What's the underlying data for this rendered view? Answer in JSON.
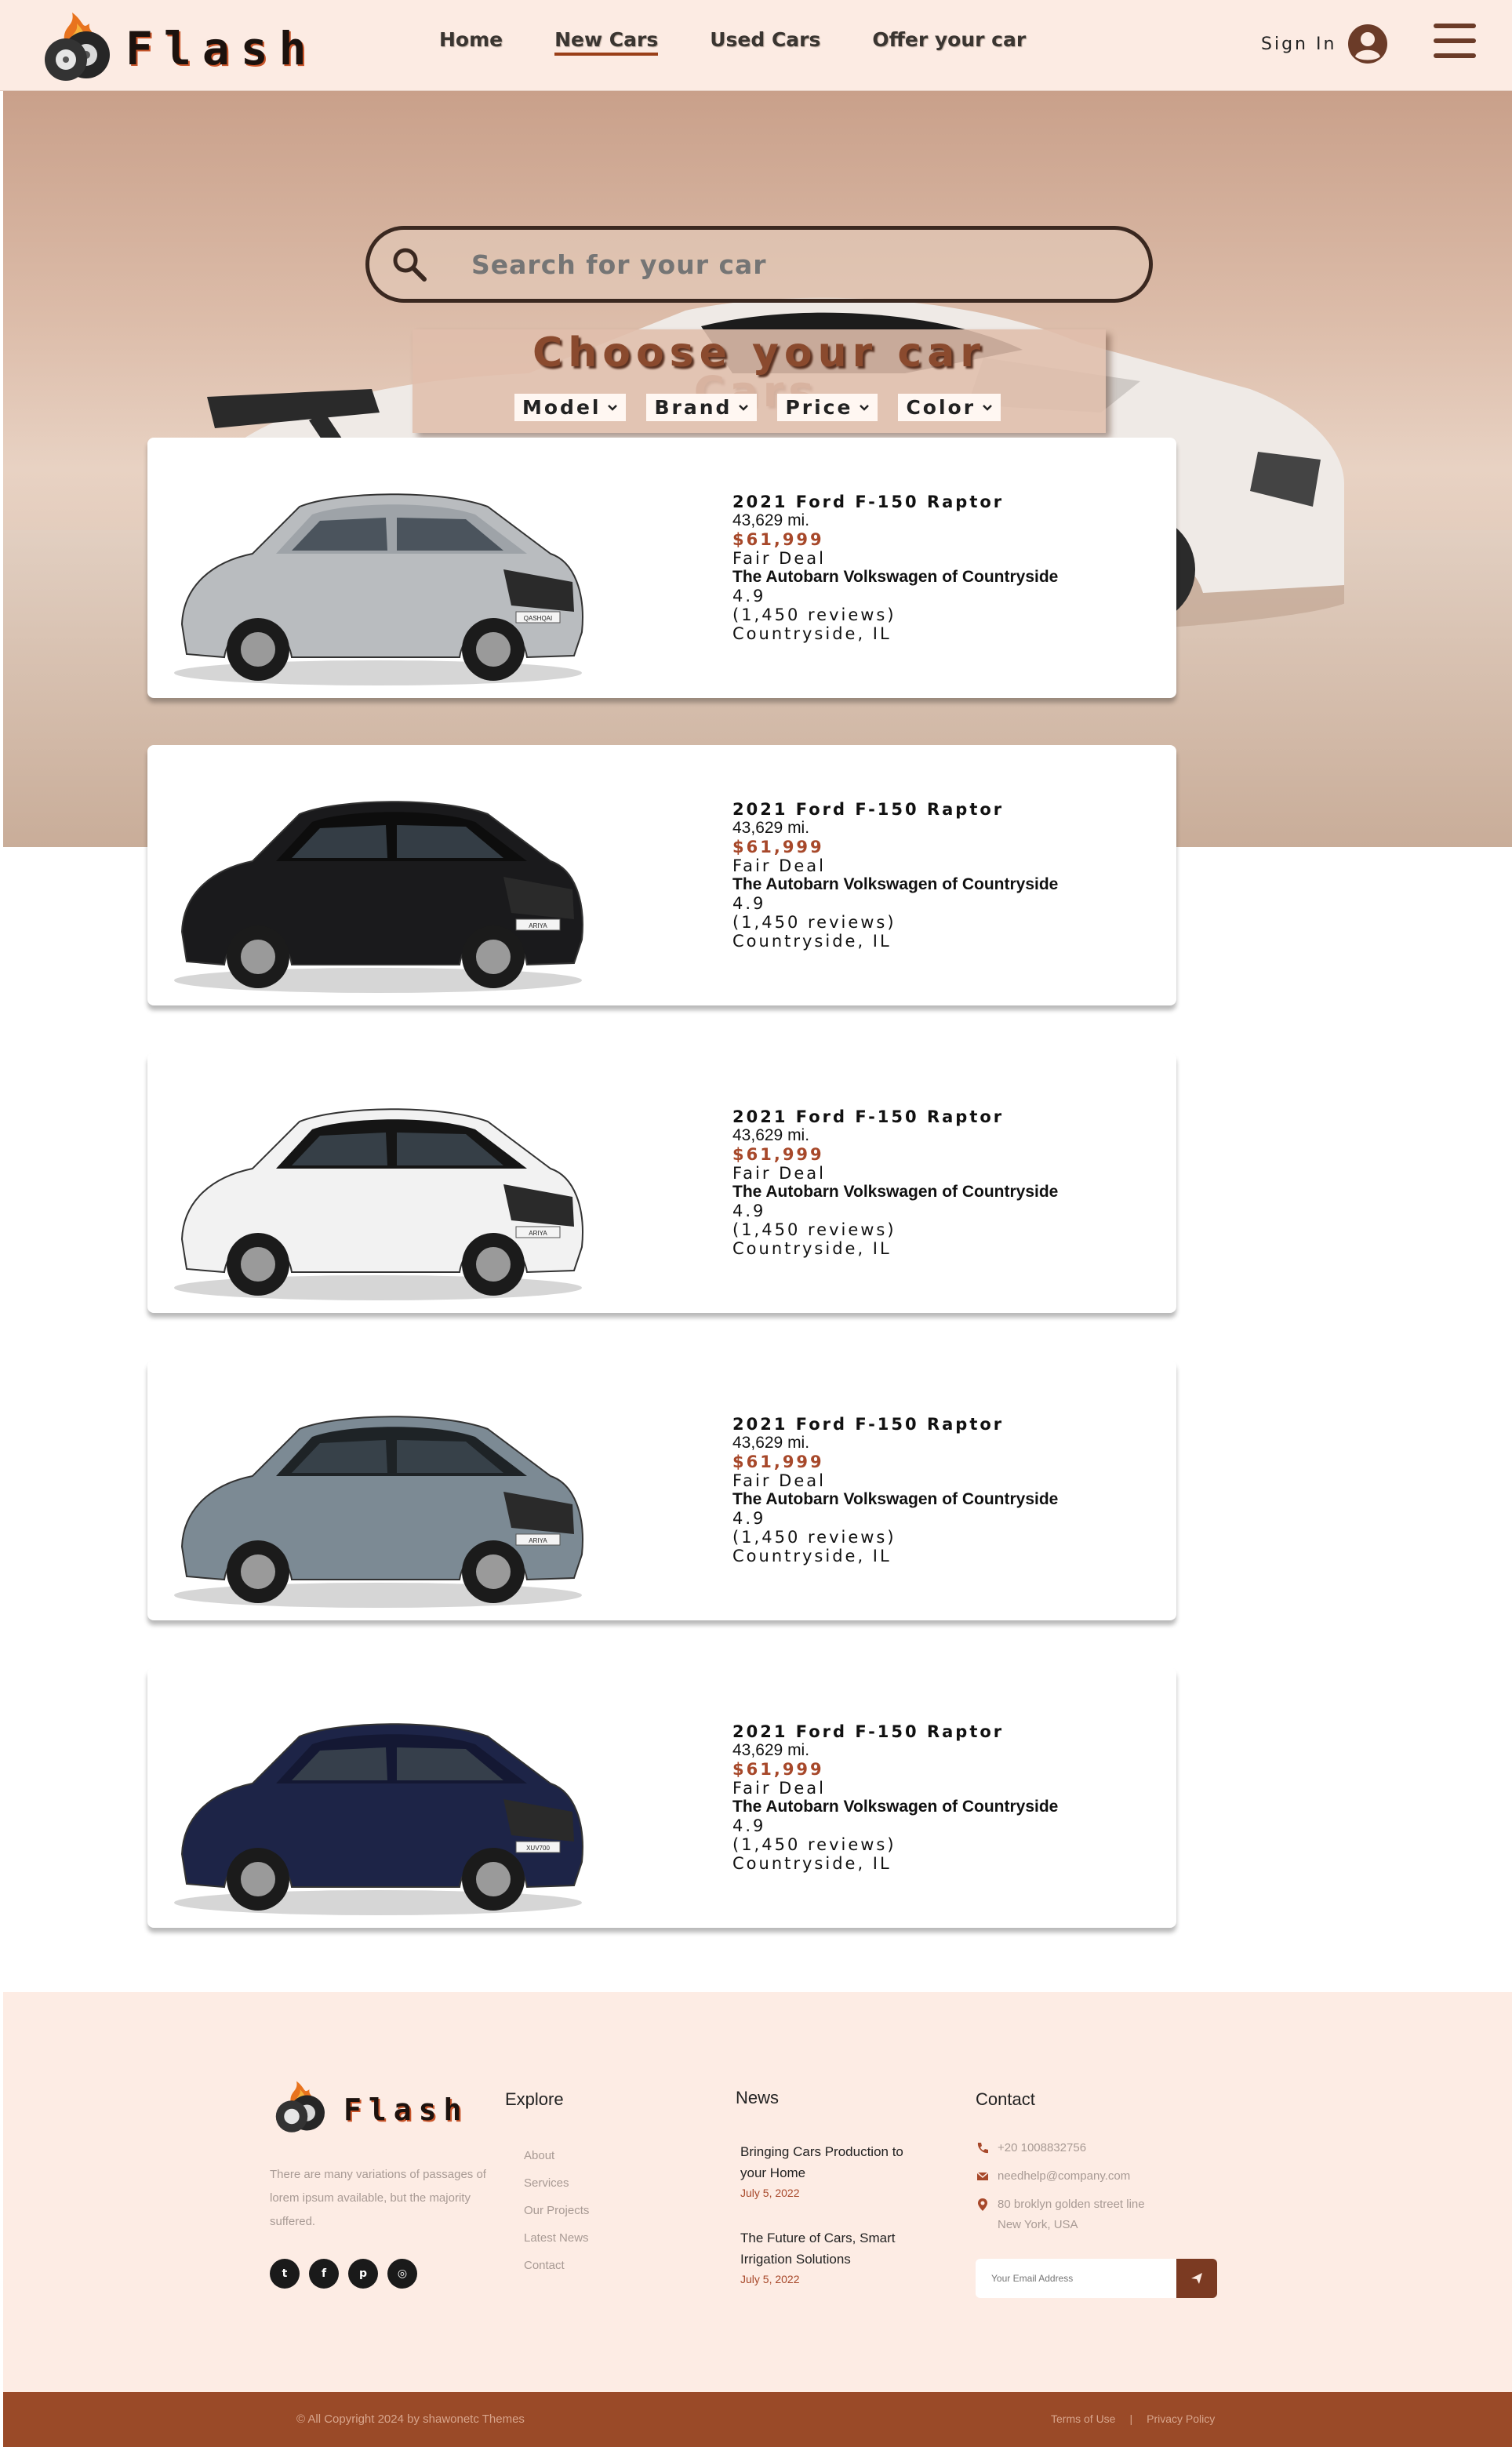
{
  "brand": {
    "name": "Flash"
  },
  "nav": {
    "items": [
      {
        "label": "Home"
      },
      {
        "label": "New Cars"
      },
      {
        "label": "Used Cars"
      },
      {
        "label": "Offer your car"
      }
    ],
    "active": "New Cars",
    "signin_label": "Sign In",
    "signin_icon": "user-circle-icon",
    "menu_icon": "hamburger-menu-icon"
  },
  "search": {
    "placeholder": "Search for your car",
    "icon": "search-icon"
  },
  "chooser": {
    "title": "Choose your car",
    "filters": [
      {
        "label": "Model"
      },
      {
        "label": "Brand"
      },
      {
        "label": "Price"
      },
      {
        "label": "Color"
      }
    ]
  },
  "section_heading": "Cars",
  "listings": [
    {
      "title": "2021 Ford F-150 Raptor",
      "mileage": "43,629 mi.",
      "price": "$61,999",
      "deal": "Fair Deal",
      "dealer": "The Autobarn Volkswagen of Countryside",
      "rating": "4.9",
      "reviews": "(1,450 reviews)",
      "location": "Countryside, IL",
      "car_color": "#b9bcbf",
      "roof_color": "#9ea3a8",
      "badge": "QASHQAI"
    },
    {
      "title": "2021 Ford F-150 Raptor",
      "mileage": "43,629 mi.",
      "price": "$61,999",
      "deal": "Fair Deal",
      "dealer": "The Autobarn Volkswagen of Countryside",
      "rating": "4.9",
      "reviews": "(1,450 reviews)",
      "location": "Countryside, IL",
      "car_color": "#1a1a1c",
      "roof_color": "#0d0d0d",
      "badge": "ARIYA"
    },
    {
      "title": "2021 Ford F-150 Raptor",
      "mileage": "43,629 mi.",
      "price": "$61,999",
      "deal": "Fair Deal",
      "dealer": "The Autobarn Volkswagen of Countryside",
      "rating": "4.9",
      "reviews": "(1,450 reviews)",
      "location": "Countryside, IL",
      "car_color": "#f2f2f2",
      "roof_color": "#151515",
      "badge": "ARIYA"
    },
    {
      "title": "2021 Ford F-150 Raptor",
      "mileage": "43,629 mi.",
      "price": "$61,999",
      "deal": "Fair Deal",
      "dealer": "The Autobarn Volkswagen of Countryside",
      "rating": "4.9",
      "reviews": "(1,450 reviews)",
      "location": "Countryside, IL",
      "car_color": "#7c8a94",
      "roof_color": "#1e2326",
      "badge": "ARIYA"
    },
    {
      "title": "2021 Ford F-150 Raptor",
      "mileage": "43,629 mi.",
      "price": "$61,999",
      "deal": "Fair Deal",
      "dealer": "The Autobarn Volkswagen of Countryside",
      "rating": "4.9",
      "reviews": "(1,450 reviews)",
      "location": "Countryside, IL",
      "car_color": "#1d2447",
      "roof_color": "#141833",
      "badge": "XUV700"
    }
  ],
  "footer": {
    "brand": "Flash",
    "description": "There are many variations of passages of lorem ipsum available, but the majority suffered.",
    "socials": [
      {
        "icon": "twitter-icon",
        "glyph": "t"
      },
      {
        "icon": "facebook-icon",
        "glyph": "f"
      },
      {
        "icon": "pinterest-icon",
        "glyph": "p"
      },
      {
        "icon": "instagram-icon",
        "glyph": "◎"
      }
    ],
    "explore": {
      "title": "Explore",
      "links": [
        "About",
        "Services",
        "Our Projects",
        "Latest News",
        "Contact"
      ]
    },
    "news": {
      "title": "News",
      "items": [
        {
          "title": "Bringing Cars Production to your Home",
          "date": "July 5, 2022"
        },
        {
          "title": "The Future of Cars, Smart Irrigation Solutions",
          "date": "July 5, 2022"
        }
      ]
    },
    "contact": {
      "title": "Contact",
      "phone": "+20 1008832756",
      "email": "needhelp@company.com",
      "address_line1": "80 broklyn golden street line",
      "address_line2": "New York, USA"
    },
    "newsletter": {
      "placeholder": "Your Email Address",
      "icon": "send-icon"
    },
    "copyright": "© All Copyright 2024 by shawonetc Themes",
    "legal": {
      "terms": "Terms of Use",
      "separator": "|",
      "privacy": "Privacy Policy"
    }
  },
  "colors": {
    "accent": "#9a4a28",
    "price": "#a7482a",
    "header_bg": "#fcebe3",
    "footer_bg": "#fdece4"
  }
}
